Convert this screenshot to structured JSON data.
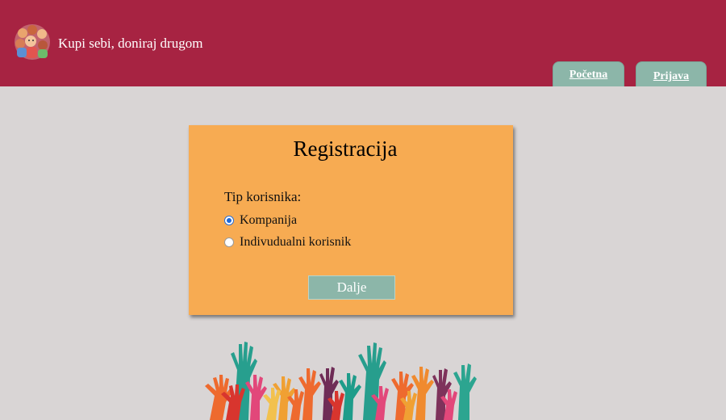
{
  "header": {
    "site_title": "Kupi sebi, doniraj drugom",
    "logo_icon": "children-group-logo",
    "nav": [
      {
        "label": "Početna"
      },
      {
        "label": "Prijava"
      }
    ]
  },
  "registration": {
    "title": "Registracija",
    "user_type_label": "Tip korisnika:",
    "options": [
      {
        "label": "Kompanija",
        "checked": true
      },
      {
        "label": "Indivudualni korisnik",
        "checked": false
      }
    ],
    "next_label": "Dalje"
  },
  "decoration": {
    "image": "raised-hands-illustration"
  },
  "colors": {
    "header": "#a72342",
    "background": "#d9d5d5",
    "card": "#f7ab52",
    "accent": "#8cb6a9"
  }
}
